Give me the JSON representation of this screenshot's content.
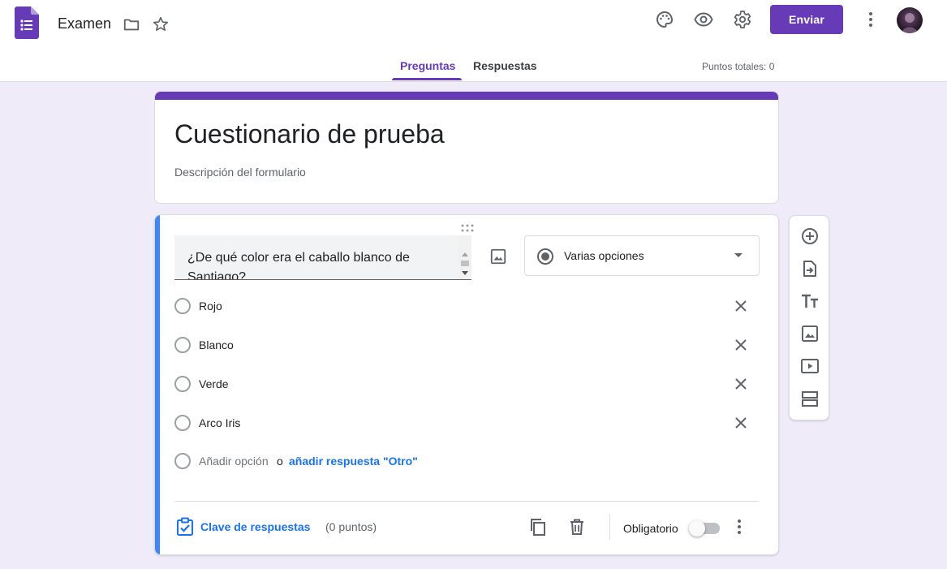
{
  "header": {
    "doc_title": "Examen",
    "send_label": "Enviar",
    "tabs": [
      {
        "label": "Preguntas",
        "active": true
      },
      {
        "label": "Respuestas",
        "active": false
      }
    ],
    "points_total": "Puntos totales: 0",
    "icons": [
      "forms-logo",
      "folder-icon",
      "star-icon",
      "palette-icon",
      "preview-eye-icon",
      "settings-gear-icon",
      "more-vert-icon"
    ]
  },
  "form": {
    "title": "Cuestionario de prueba",
    "description_placeholder": "Descripción del formulario"
  },
  "question": {
    "text": "¿De qué color era el caballo blanco de Santiago?",
    "type_label": "Varias opciones",
    "options": [
      {
        "label": "Rojo"
      },
      {
        "label": "Blanco"
      },
      {
        "label": "Verde"
      },
      {
        "label": "Arco Iris"
      }
    ],
    "add_option": "Añadir opción",
    "or": "o",
    "add_other": "añadir respuesta \"Otro\"",
    "answer_key": "Clave de respuestas",
    "points": "(0 puntos)",
    "required_label": "Obligatorio",
    "required": false
  },
  "toolbar": {
    "items": [
      "add-question-icon",
      "import-questions-icon",
      "add-title-icon",
      "add-image-icon",
      "add-video-icon",
      "add-section-icon"
    ]
  },
  "colors": {
    "accent": "#673ab7",
    "background": "#f0ebf8",
    "active_bar": "#4285f4",
    "link": "#1a73e8"
  }
}
